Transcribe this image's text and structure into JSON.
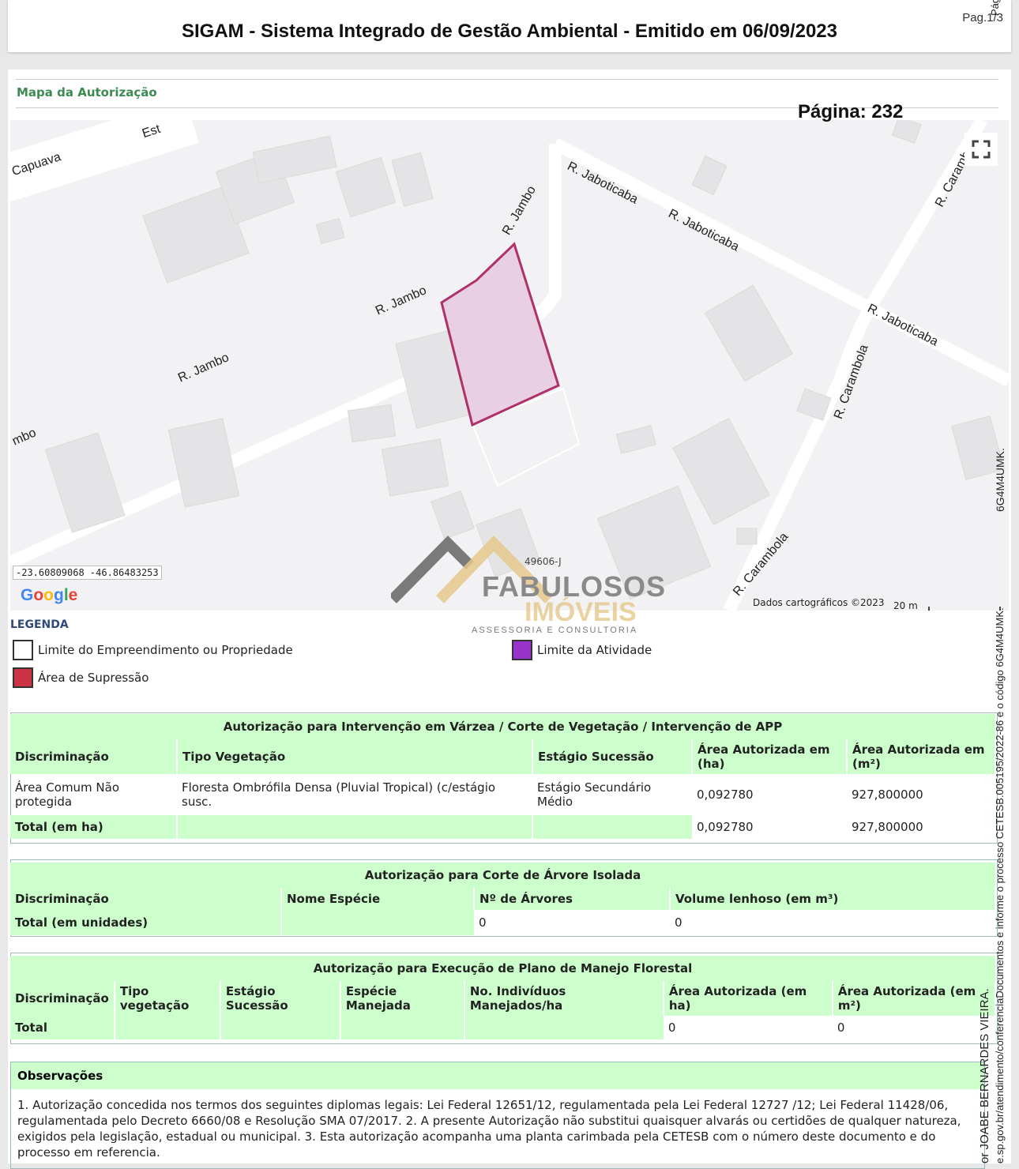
{
  "header": {
    "title": "SIGAM - Sistema Integrado de Gestão Ambiental - Emitido em 06/09/2023",
    "page_ref": "Pag.1/3"
  },
  "section": {
    "title": "Mapa da Autorização",
    "pagina": "Página: 232"
  },
  "map": {
    "streets": [
      "Capuava",
      "Est",
      "R. Jambo",
      "R. Jambo",
      "R. Jambo",
      "mbo",
      "R. Jaboticaba",
      "R. Jaboticaba",
      "R. Jaboticaba",
      "R. Carambola",
      "R. Carambola",
      "R. Carambola"
    ],
    "coords": "-23.60809068 -46.86483253",
    "google": "Google",
    "credits": "Dados cartográficos ©2023",
    "scale": "20 m",
    "fullscreen_icon": "fullscreen-icon"
  },
  "watermark": {
    "code": "49606-J",
    "brand1": "FABULOSOS",
    "brand2": "IMÓVEIS",
    "tagline": "ASSESSORIA E CONSULTORIA"
  },
  "legend": {
    "title": "LEGENDA",
    "items": [
      {
        "label": "Limite do Empreendimento ou Propriedade",
        "color": "#ffffff"
      },
      {
        "label": "Limite da Atividade",
        "color": "#9933cc"
      },
      {
        "label": "Área de Supressão",
        "color": "#cc3344"
      }
    ]
  },
  "table1": {
    "caption": "Autorização para Intervenção em Várzea / Corte de Vegetação / Intervenção de APP",
    "headers": [
      "Discriminação",
      "Tipo Vegetação",
      "Estágio Sucessão",
      "Área Autorizada em (ha)",
      "Área Autorizada em (m²)"
    ],
    "row": [
      "Área Comum Não protegida",
      "Floresta Ombrófila Densa (Pluvial Tropical) (c/estágio susc.",
      "Estágio Secundário Médio",
      "0,092780",
      "927,800000"
    ],
    "total": [
      "Total (em ha)",
      "",
      "",
      "0,092780",
      "927,800000"
    ]
  },
  "table2": {
    "caption": "Autorização para Corte de Árvore Isolada",
    "headers": [
      "Discriminação",
      "Nome Espécie",
      "Nº de Árvores",
      "Volume lenhoso (em m³)"
    ],
    "total": [
      "Total (em unidades)",
      "",
      "0",
      "0"
    ]
  },
  "table3": {
    "caption": "Autorização para Execução de Plano de Manejo Florestal",
    "headers": [
      "Discriminação",
      "Tipo vegetação",
      "Estágio Sucessão",
      "Espécie Manejada",
      "No. Indivíduos Manejados/ha",
      "Área Autorizada (em ha)",
      "Área Autorizada (em m²)"
    ],
    "total": [
      "Total",
      "",
      "",
      "",
      "",
      "0",
      "0"
    ]
  },
  "observacoes": {
    "title": "Observações",
    "text": "1. Autorização concedida nos termos dos seguintes diplomas legais: Lei Federal 12651/12, regulamentada pela Lei Federal 12727 /12; Lei Federal 11428/06, regulamentada pelo Decreto 6660/08 e Resolução SMA 07/2017. 2. A presente Autorização não substitui quaisquer alvarás ou certidões de qualquer natureza, exigidos pela legislação, estadual ou municipal. 3. Esta autorização acompanha uma planta carimbada pela CETESB com o número deste documento e do processo em referencia."
  },
  "sidebar": {
    "line1": "6G4M4UMK.",
    "line2": "e.sp.gov.br/atendimento/conferenciaDocumentos e informe o processo CETESB.005195/2022-86 e o código 6G4M4UMK.",
    "line3": "or JOABE BERNARDES VIEIRA.",
    "line4": "Pág Par"
  }
}
